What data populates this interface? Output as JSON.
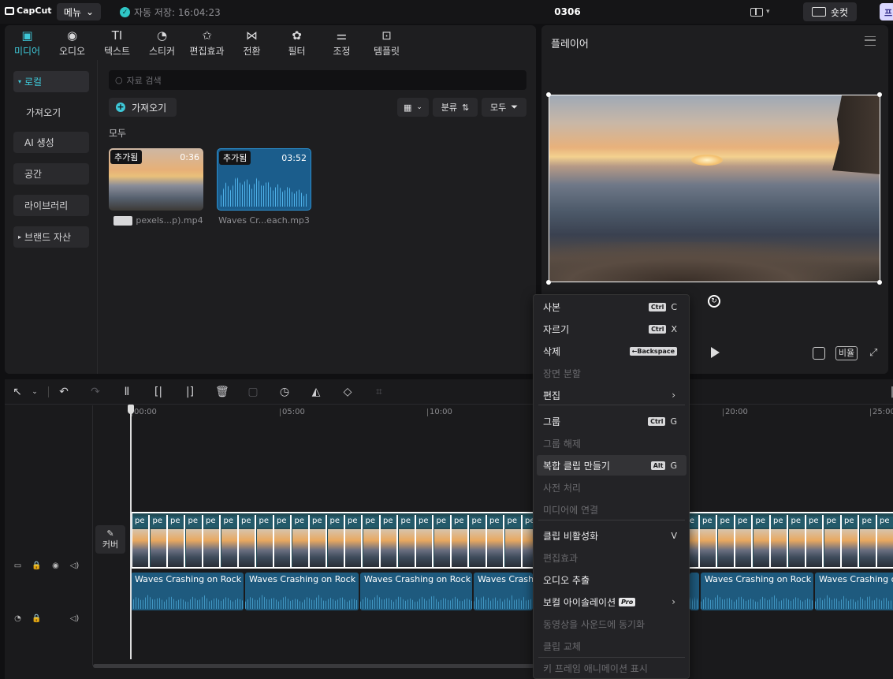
{
  "titlebar": {
    "logo": "CapCut",
    "menu_label": "메뉴",
    "autosave": "자동 저장: 16:04:23",
    "project_title": "0306",
    "shortcut_label": "숏컷",
    "pro_label": "프"
  },
  "tabs": [
    {
      "label": "미디어",
      "icon": "media-icon"
    },
    {
      "label": "오디오",
      "icon": "audio-icon"
    },
    {
      "label": "텍스트",
      "icon": "text-icon"
    },
    {
      "label": "스티커",
      "icon": "sticker-icon"
    },
    {
      "label": "편집효과",
      "icon": "effects-icon"
    },
    {
      "label": "전환",
      "icon": "transition-icon"
    },
    {
      "label": "필터",
      "icon": "filter-icon"
    },
    {
      "label": "조정",
      "icon": "adjust-icon"
    },
    {
      "label": "템플릿",
      "icon": "template-icon"
    }
  ],
  "sidebar": {
    "items": [
      "로컬",
      "가져오기",
      "AI 생성",
      "공간",
      "라이브러리",
      "브랜드 자산"
    ]
  },
  "media": {
    "search_placeholder": "자료 검색",
    "import_label": "가져오기",
    "sort_label": "분류",
    "filter_label": "모두",
    "section_label": "모두",
    "items": [
      {
        "badge": "추가됨",
        "duration": "0:36",
        "name": "pexels...p).mp4"
      },
      {
        "badge": "추가됨",
        "duration": "03:52",
        "name": "Waves Cr...each.mp3"
      }
    ]
  },
  "player": {
    "title": "플레이어",
    "ratio_label": "비율"
  },
  "timeline": {
    "ruler": [
      "00:00",
      "05:00",
      "10:00",
      "20:00",
      "25:00"
    ],
    "cover_label": "커버",
    "frame_label": "pe",
    "audio_clip_title": "Waves Crashing on Rock B",
    "audio_clip_title_short": "Waves Crashi"
  },
  "context_menu": {
    "items": [
      {
        "label": "사본",
        "key": "Ctrl",
        "letter": "C",
        "disabled": false
      },
      {
        "label": "자르기",
        "key": "Ctrl",
        "letter": "X",
        "disabled": false
      },
      {
        "label": "삭제",
        "key": "←Backspace",
        "letter": "",
        "disabled": false
      },
      {
        "label": "장면 분할",
        "disabled": true
      },
      {
        "label": "편집",
        "submenu": true,
        "disabled": false
      },
      {
        "label": "그룹",
        "key": "Ctrl",
        "letter": "G",
        "disabled": false
      },
      {
        "label": "그룹 해제",
        "disabled": true
      },
      {
        "label": "복합 클립 만들기",
        "key": "Alt",
        "letter": "G",
        "disabled": false
      },
      {
        "label": "사전 처리",
        "disabled": true
      },
      {
        "label": "미디어에 연결",
        "disabled": true
      },
      {
        "label": "클립 비활성화",
        "letter": "V",
        "disabled": false
      },
      {
        "label": "편집효과",
        "disabled": true
      },
      {
        "label": "오디오 추출",
        "disabled": false
      },
      {
        "label": "보컬 아이솔레이션",
        "badge": "Pro",
        "submenu": true,
        "disabled": false
      },
      {
        "label": "동영상을 사운드에 동기화",
        "disabled": true
      },
      {
        "label": "클립 교체",
        "disabled": true
      },
      {
        "label": "키 프레임 애니메이션 표시",
        "disabled": true
      }
    ]
  },
  "colors": {
    "accent": "#3ec8d8",
    "audio_clip": "#1e5a7e",
    "video_track": "#224c56"
  }
}
